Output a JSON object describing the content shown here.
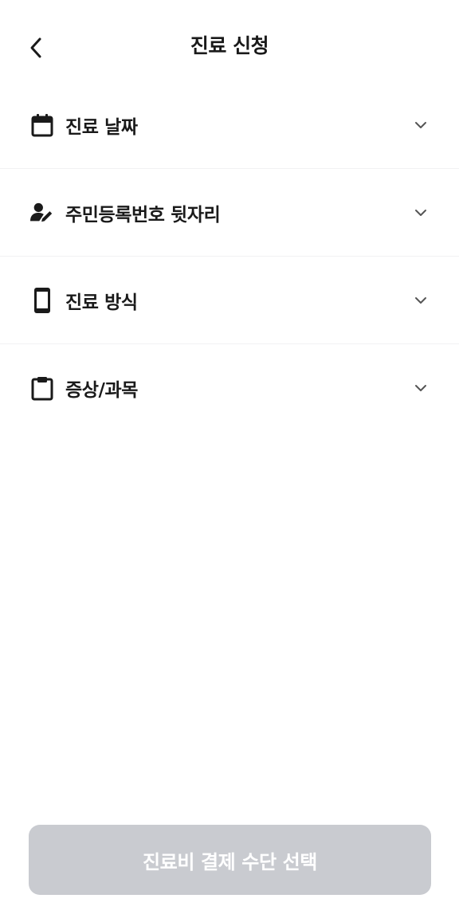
{
  "header": {
    "title": "진료 신청",
    "back_icon": "chevron-left-icon"
  },
  "rows": [
    {
      "label": "진료 날짜",
      "icon": "calendar-icon"
    },
    {
      "label": "주민등록번호 뒷자리",
      "icon": "user-edit-icon"
    },
    {
      "label": "진료 방식",
      "icon": "smartphone-icon"
    },
    {
      "label": "증상/과목",
      "icon": "clipboard-icon"
    }
  ],
  "cta": {
    "label": "진료비 결제 수단 선택",
    "enabled": false
  },
  "colors": {
    "text": "#1a1a1a",
    "divider": "#f1f1f3",
    "cta_disabled_bg": "#c9cbd0",
    "cta_text": "#ffffff"
  }
}
